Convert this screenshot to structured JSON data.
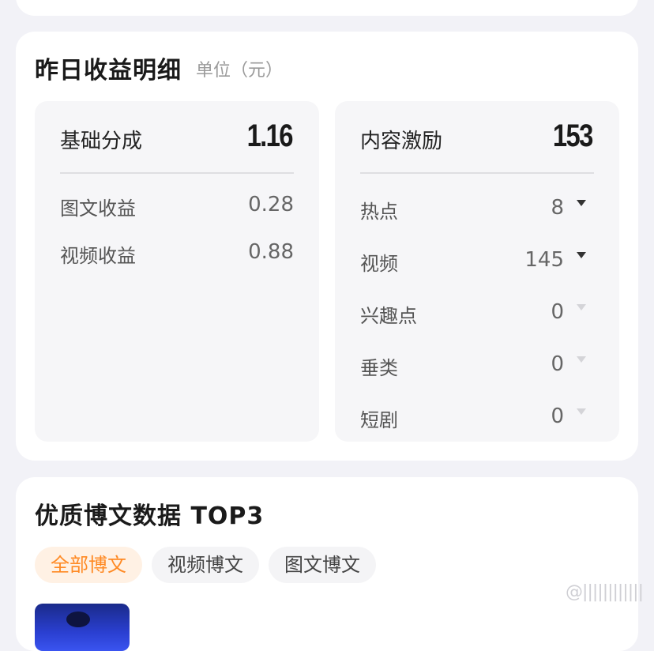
{
  "earnings": {
    "title": "昨日收益明细",
    "unit": "单位（元）",
    "basic": {
      "label": "基础分成",
      "value": "1.16",
      "rows": [
        {
          "label": "图文收益",
          "value": "0.28"
        },
        {
          "label": "视频收益",
          "value": "0.88"
        }
      ]
    },
    "incentive": {
      "label": "内容激励",
      "value": "153",
      "rows": [
        {
          "label": "热点",
          "value": "8"
        },
        {
          "label": "视频",
          "value": "145"
        },
        {
          "label": "兴趣点",
          "value": "0"
        },
        {
          "label": "垂类",
          "value": "0"
        },
        {
          "label": "短剧",
          "value": "0"
        }
      ]
    }
  },
  "top3": {
    "title": "优质博文数据 TOP3",
    "tabs": [
      "全部博文",
      "视频博文",
      "图文博文"
    ],
    "active_tab": "全部博文"
  },
  "watermark": {
    "text": "@||||||||||||"
  },
  "colors": {
    "accent": "#ff8a24",
    "accent_bg": "#fff1e4",
    "page_bg": "#f2f2f7"
  }
}
